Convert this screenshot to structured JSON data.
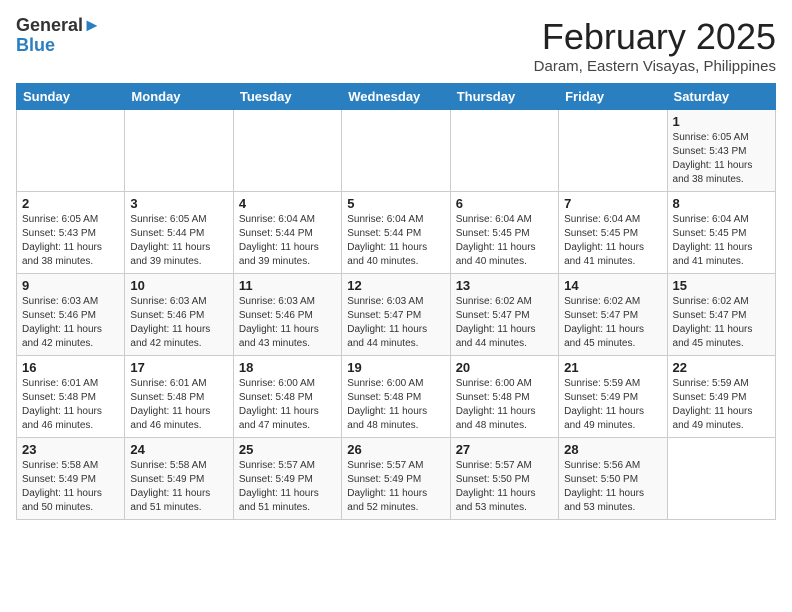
{
  "header": {
    "logo_general": "General",
    "logo_blue": "Blue",
    "title": "February 2025",
    "subtitle": "Daram, Eastern Visayas, Philippines"
  },
  "weekdays": [
    "Sunday",
    "Monday",
    "Tuesday",
    "Wednesday",
    "Thursday",
    "Friday",
    "Saturday"
  ],
  "weeks": [
    [
      {
        "day": "",
        "info": ""
      },
      {
        "day": "",
        "info": ""
      },
      {
        "day": "",
        "info": ""
      },
      {
        "day": "",
        "info": ""
      },
      {
        "day": "",
        "info": ""
      },
      {
        "day": "",
        "info": ""
      },
      {
        "day": "1",
        "info": "Sunrise: 6:05 AM\nSunset: 5:43 PM\nDaylight: 11 hours\nand 38 minutes."
      }
    ],
    [
      {
        "day": "2",
        "info": "Sunrise: 6:05 AM\nSunset: 5:43 PM\nDaylight: 11 hours\nand 38 minutes."
      },
      {
        "day": "3",
        "info": "Sunrise: 6:05 AM\nSunset: 5:44 PM\nDaylight: 11 hours\nand 39 minutes."
      },
      {
        "day": "4",
        "info": "Sunrise: 6:04 AM\nSunset: 5:44 PM\nDaylight: 11 hours\nand 39 minutes."
      },
      {
        "day": "5",
        "info": "Sunrise: 6:04 AM\nSunset: 5:44 PM\nDaylight: 11 hours\nand 40 minutes."
      },
      {
        "day": "6",
        "info": "Sunrise: 6:04 AM\nSunset: 5:45 PM\nDaylight: 11 hours\nand 40 minutes."
      },
      {
        "day": "7",
        "info": "Sunrise: 6:04 AM\nSunset: 5:45 PM\nDaylight: 11 hours\nand 41 minutes."
      },
      {
        "day": "8",
        "info": "Sunrise: 6:04 AM\nSunset: 5:45 PM\nDaylight: 11 hours\nand 41 minutes."
      }
    ],
    [
      {
        "day": "9",
        "info": "Sunrise: 6:03 AM\nSunset: 5:46 PM\nDaylight: 11 hours\nand 42 minutes."
      },
      {
        "day": "10",
        "info": "Sunrise: 6:03 AM\nSunset: 5:46 PM\nDaylight: 11 hours\nand 42 minutes."
      },
      {
        "day": "11",
        "info": "Sunrise: 6:03 AM\nSunset: 5:46 PM\nDaylight: 11 hours\nand 43 minutes."
      },
      {
        "day": "12",
        "info": "Sunrise: 6:03 AM\nSunset: 5:47 PM\nDaylight: 11 hours\nand 44 minutes."
      },
      {
        "day": "13",
        "info": "Sunrise: 6:02 AM\nSunset: 5:47 PM\nDaylight: 11 hours\nand 44 minutes."
      },
      {
        "day": "14",
        "info": "Sunrise: 6:02 AM\nSunset: 5:47 PM\nDaylight: 11 hours\nand 45 minutes."
      },
      {
        "day": "15",
        "info": "Sunrise: 6:02 AM\nSunset: 5:47 PM\nDaylight: 11 hours\nand 45 minutes."
      }
    ],
    [
      {
        "day": "16",
        "info": "Sunrise: 6:01 AM\nSunset: 5:48 PM\nDaylight: 11 hours\nand 46 minutes."
      },
      {
        "day": "17",
        "info": "Sunrise: 6:01 AM\nSunset: 5:48 PM\nDaylight: 11 hours\nand 46 minutes."
      },
      {
        "day": "18",
        "info": "Sunrise: 6:00 AM\nSunset: 5:48 PM\nDaylight: 11 hours\nand 47 minutes."
      },
      {
        "day": "19",
        "info": "Sunrise: 6:00 AM\nSunset: 5:48 PM\nDaylight: 11 hours\nand 48 minutes."
      },
      {
        "day": "20",
        "info": "Sunrise: 6:00 AM\nSunset: 5:48 PM\nDaylight: 11 hours\nand 48 minutes."
      },
      {
        "day": "21",
        "info": "Sunrise: 5:59 AM\nSunset: 5:49 PM\nDaylight: 11 hours\nand 49 minutes."
      },
      {
        "day": "22",
        "info": "Sunrise: 5:59 AM\nSunset: 5:49 PM\nDaylight: 11 hours\nand 49 minutes."
      }
    ],
    [
      {
        "day": "23",
        "info": "Sunrise: 5:58 AM\nSunset: 5:49 PM\nDaylight: 11 hours\nand 50 minutes."
      },
      {
        "day": "24",
        "info": "Sunrise: 5:58 AM\nSunset: 5:49 PM\nDaylight: 11 hours\nand 51 minutes."
      },
      {
        "day": "25",
        "info": "Sunrise: 5:57 AM\nSunset: 5:49 PM\nDaylight: 11 hours\nand 51 minutes."
      },
      {
        "day": "26",
        "info": "Sunrise: 5:57 AM\nSunset: 5:49 PM\nDaylight: 11 hours\nand 52 minutes."
      },
      {
        "day": "27",
        "info": "Sunrise: 5:57 AM\nSunset: 5:50 PM\nDaylight: 11 hours\nand 53 minutes."
      },
      {
        "day": "28",
        "info": "Sunrise: 5:56 AM\nSunset: 5:50 PM\nDaylight: 11 hours\nand 53 minutes."
      },
      {
        "day": "",
        "info": ""
      }
    ]
  ]
}
